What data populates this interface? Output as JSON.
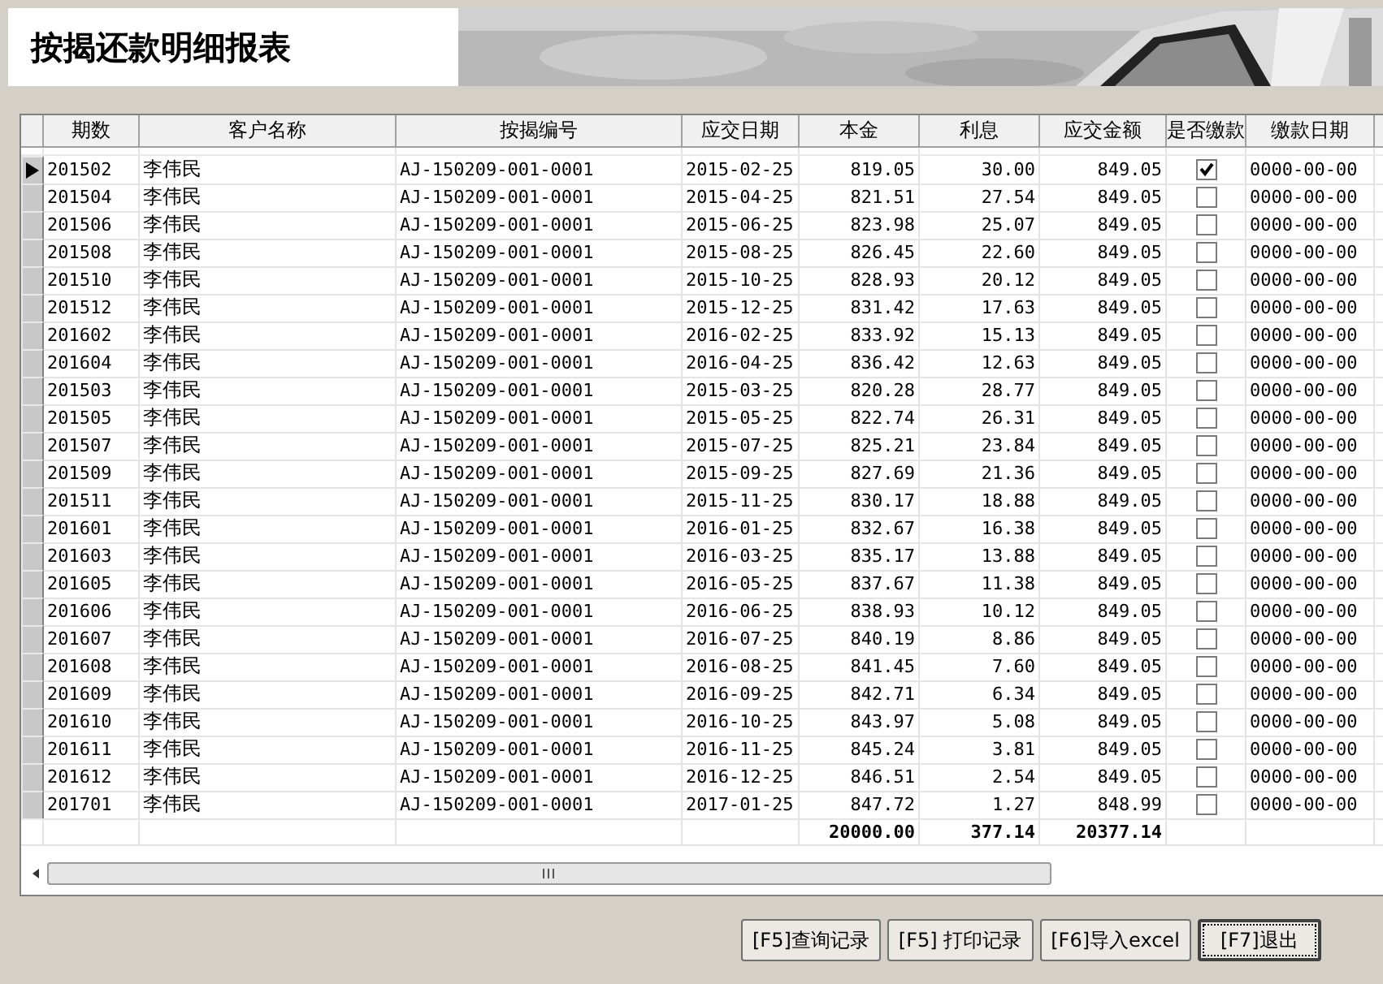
{
  "title": "按揭还款明细报表",
  "table": {
    "columns": [
      "期数",
      "客户名称",
      "按揭编号",
      "应交日期",
      "本金",
      "利息",
      "应交金额",
      "是否缴款",
      "缴款日期"
    ],
    "rows": [
      {
        "period": "201502",
        "customer": "李伟民",
        "loan_no": "AJ-150209-001-0001",
        "due_date": "2015-02-25",
        "principal": "819.05",
        "interest": "30.00",
        "amount": "849.05",
        "paid": true,
        "pay_date": "0000-00-00",
        "selected": true
      },
      {
        "period": "201504",
        "customer": "李伟民",
        "loan_no": "AJ-150209-001-0001",
        "due_date": "2015-04-25",
        "principal": "821.51",
        "interest": "27.54",
        "amount": "849.05",
        "paid": false,
        "pay_date": "0000-00-00",
        "selected": false
      },
      {
        "period": "201506",
        "customer": "李伟民",
        "loan_no": "AJ-150209-001-0001",
        "due_date": "2015-06-25",
        "principal": "823.98",
        "interest": "25.07",
        "amount": "849.05",
        "paid": false,
        "pay_date": "0000-00-00",
        "selected": false
      },
      {
        "period": "201508",
        "customer": "李伟民",
        "loan_no": "AJ-150209-001-0001",
        "due_date": "2015-08-25",
        "principal": "826.45",
        "interest": "22.60",
        "amount": "849.05",
        "paid": false,
        "pay_date": "0000-00-00",
        "selected": false
      },
      {
        "period": "201510",
        "customer": "李伟民",
        "loan_no": "AJ-150209-001-0001",
        "due_date": "2015-10-25",
        "principal": "828.93",
        "interest": "20.12",
        "amount": "849.05",
        "paid": false,
        "pay_date": "0000-00-00",
        "selected": false
      },
      {
        "period": "201512",
        "customer": "李伟民",
        "loan_no": "AJ-150209-001-0001",
        "due_date": "2015-12-25",
        "principal": "831.42",
        "interest": "17.63",
        "amount": "849.05",
        "paid": false,
        "pay_date": "0000-00-00",
        "selected": false
      },
      {
        "period": "201602",
        "customer": "李伟民",
        "loan_no": "AJ-150209-001-0001",
        "due_date": "2016-02-25",
        "principal": "833.92",
        "interest": "15.13",
        "amount": "849.05",
        "paid": false,
        "pay_date": "0000-00-00",
        "selected": false
      },
      {
        "period": "201604",
        "customer": "李伟民",
        "loan_no": "AJ-150209-001-0001",
        "due_date": "2016-04-25",
        "principal": "836.42",
        "interest": "12.63",
        "amount": "849.05",
        "paid": false,
        "pay_date": "0000-00-00",
        "selected": false
      },
      {
        "period": "201503",
        "customer": "李伟民",
        "loan_no": "AJ-150209-001-0001",
        "due_date": "2015-03-25",
        "principal": "820.28",
        "interest": "28.77",
        "amount": "849.05",
        "paid": false,
        "pay_date": "0000-00-00",
        "selected": false
      },
      {
        "period": "201505",
        "customer": "李伟民",
        "loan_no": "AJ-150209-001-0001",
        "due_date": "2015-05-25",
        "principal": "822.74",
        "interest": "26.31",
        "amount": "849.05",
        "paid": false,
        "pay_date": "0000-00-00",
        "selected": false
      },
      {
        "period": "201507",
        "customer": "李伟民",
        "loan_no": "AJ-150209-001-0001",
        "due_date": "2015-07-25",
        "principal": "825.21",
        "interest": "23.84",
        "amount": "849.05",
        "paid": false,
        "pay_date": "0000-00-00",
        "selected": false
      },
      {
        "period": "201509",
        "customer": "李伟民",
        "loan_no": "AJ-150209-001-0001",
        "due_date": "2015-09-25",
        "principal": "827.69",
        "interest": "21.36",
        "amount": "849.05",
        "paid": false,
        "pay_date": "0000-00-00",
        "selected": false
      },
      {
        "period": "201511",
        "customer": "李伟民",
        "loan_no": "AJ-150209-001-0001",
        "due_date": "2015-11-25",
        "principal": "830.17",
        "interest": "18.88",
        "amount": "849.05",
        "paid": false,
        "pay_date": "0000-00-00",
        "selected": false
      },
      {
        "period": "201601",
        "customer": "李伟民",
        "loan_no": "AJ-150209-001-0001",
        "due_date": "2016-01-25",
        "principal": "832.67",
        "interest": "16.38",
        "amount": "849.05",
        "paid": false,
        "pay_date": "0000-00-00",
        "selected": false
      },
      {
        "period": "201603",
        "customer": "李伟民",
        "loan_no": "AJ-150209-001-0001",
        "due_date": "2016-03-25",
        "principal": "835.17",
        "interest": "13.88",
        "amount": "849.05",
        "paid": false,
        "pay_date": "0000-00-00",
        "selected": false
      },
      {
        "period": "201605",
        "customer": "李伟民",
        "loan_no": "AJ-150209-001-0001",
        "due_date": "2016-05-25",
        "principal": "837.67",
        "interest": "11.38",
        "amount": "849.05",
        "paid": false,
        "pay_date": "0000-00-00",
        "selected": false
      },
      {
        "period": "201606",
        "customer": "李伟民",
        "loan_no": "AJ-150209-001-0001",
        "due_date": "2016-06-25",
        "principal": "838.93",
        "interest": "10.12",
        "amount": "849.05",
        "paid": false,
        "pay_date": "0000-00-00",
        "selected": false
      },
      {
        "period": "201607",
        "customer": "李伟民",
        "loan_no": "AJ-150209-001-0001",
        "due_date": "2016-07-25",
        "principal": "840.19",
        "interest": "8.86",
        "amount": "849.05",
        "paid": false,
        "pay_date": "0000-00-00",
        "selected": false
      },
      {
        "period": "201608",
        "customer": "李伟民",
        "loan_no": "AJ-150209-001-0001",
        "due_date": "2016-08-25",
        "principal": "841.45",
        "interest": "7.60",
        "amount": "849.05",
        "paid": false,
        "pay_date": "0000-00-00",
        "selected": false
      },
      {
        "period": "201609",
        "customer": "李伟民",
        "loan_no": "AJ-150209-001-0001",
        "due_date": "2016-09-25",
        "principal": "842.71",
        "interest": "6.34",
        "amount": "849.05",
        "paid": false,
        "pay_date": "0000-00-00",
        "selected": false
      },
      {
        "period": "201610",
        "customer": "李伟民",
        "loan_no": "AJ-150209-001-0001",
        "due_date": "2016-10-25",
        "principal": "843.97",
        "interest": "5.08",
        "amount": "849.05",
        "paid": false,
        "pay_date": "0000-00-00",
        "selected": false
      },
      {
        "period": "201611",
        "customer": "李伟民",
        "loan_no": "AJ-150209-001-0001",
        "due_date": "2016-11-25",
        "principal": "845.24",
        "interest": "3.81",
        "amount": "849.05",
        "paid": false,
        "pay_date": "0000-00-00",
        "selected": false
      },
      {
        "period": "201612",
        "customer": "李伟民",
        "loan_no": "AJ-150209-001-0001",
        "due_date": "2016-12-25",
        "principal": "846.51",
        "interest": "2.54",
        "amount": "849.05",
        "paid": false,
        "pay_date": "0000-00-00",
        "selected": false
      },
      {
        "period": "201701",
        "customer": "李伟民",
        "loan_no": "AJ-150209-001-0001",
        "due_date": "2017-01-25",
        "principal": "847.72",
        "interest": "1.27",
        "amount": "848.99",
        "paid": false,
        "pay_date": "0000-00-00",
        "selected": false
      }
    ],
    "totals": {
      "principal": "20000.00",
      "interest": "377.14",
      "amount": "20377.14"
    }
  },
  "buttons": [
    {
      "label": "[F5]查询记录",
      "default": false
    },
    {
      "label": "[F5] 打印记录",
      "default": false
    },
    {
      "label": "[F6]导入excel",
      "default": false
    },
    {
      "label": "[F7]退出",
      "default": true
    }
  ]
}
